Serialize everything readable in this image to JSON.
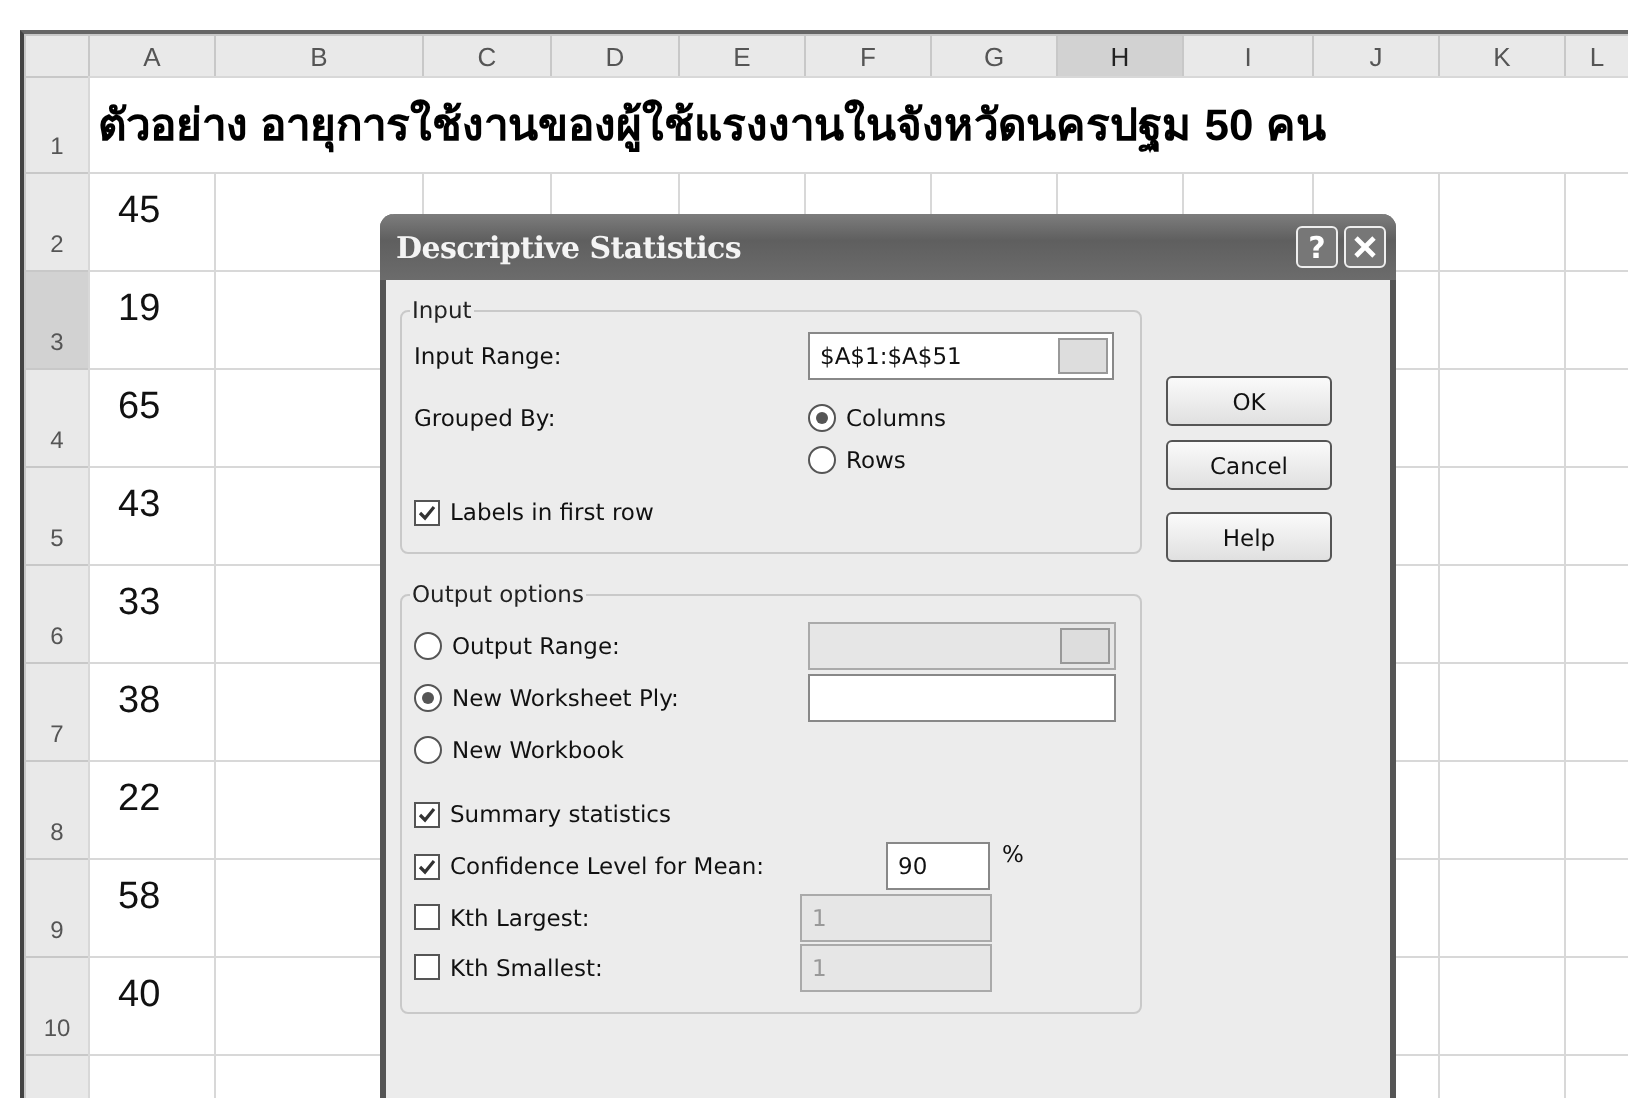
{
  "sheet": {
    "columns": [
      {
        "label": "A",
        "selected": false
      },
      {
        "label": "B",
        "selected": false
      },
      {
        "label": "C",
        "selected": false
      },
      {
        "label": "D",
        "selected": false
      },
      {
        "label": "E",
        "selected": false
      },
      {
        "label": "F",
        "selected": false
      },
      {
        "label": "G",
        "selected": false
      },
      {
        "label": "H",
        "selected": true
      },
      {
        "label": "I",
        "selected": false
      },
      {
        "label": "J",
        "selected": false
      },
      {
        "label": "K",
        "selected": false
      },
      {
        "label": "L",
        "selected": false
      }
    ],
    "rows": [
      {
        "number": "1",
        "selected": false,
        "value": "ตัวอย่าง อายุการใช้งานของผู้ใช้แรงงานในจังหวัดนครปฐม 50 คน"
      },
      {
        "number": "2",
        "selected": false,
        "value": "45"
      },
      {
        "number": "3",
        "selected": true,
        "value": "19"
      },
      {
        "number": "4",
        "selected": false,
        "value": "65"
      },
      {
        "number": "5",
        "selected": false,
        "value": "43"
      },
      {
        "number": "6",
        "selected": false,
        "value": "33"
      },
      {
        "number": "7",
        "selected": false,
        "value": "38"
      },
      {
        "number": "8",
        "selected": false,
        "value": "22"
      },
      {
        "number": "9",
        "selected": false,
        "value": "58"
      },
      {
        "number": "10",
        "selected": false,
        "value": "40"
      }
    ]
  },
  "dialog": {
    "title": "Descriptive Statistics",
    "help_glyph": "?",
    "input": {
      "legend": "Input",
      "input_range": {
        "label": "Input Range:",
        "value": "$A$1:$A$51"
      },
      "grouped_by": {
        "label": "Grouped By:",
        "options": [
          {
            "label": "Columns",
            "selected": true
          },
          {
            "label": "Rows",
            "selected": false
          }
        ]
      },
      "labels_in_first_row": {
        "label": "Labels in first row",
        "checked": true
      }
    },
    "output": {
      "legend": "Output options",
      "destinations": [
        {
          "label": "Output Range:",
          "selected": false,
          "field": {
            "disabled": true,
            "ref_button": true
          }
        },
        {
          "label": "New Worksheet Ply:",
          "selected": true,
          "field": {
            "disabled": false
          }
        },
        {
          "label": "New Workbook",
          "selected": false
        }
      ],
      "options": [
        {
          "kind": "plain",
          "label": "Summary statistics",
          "checked": true
        },
        {
          "kind": "percent",
          "label": "Confidence Level for Mean:",
          "checked": true,
          "value": "90",
          "suffix": "%",
          "disabled": false
        },
        {
          "kind": "rank",
          "label": "Kth Largest:",
          "checked": false,
          "value": "1",
          "disabled": true
        },
        {
          "kind": "rank",
          "label": "Kth Smallest:",
          "checked": false,
          "value": "1",
          "disabled": true
        }
      ]
    },
    "buttons": [
      {
        "label": "OK"
      },
      {
        "label": "Cancel"
      },
      {
        "label": "Help"
      }
    ]
  }
}
